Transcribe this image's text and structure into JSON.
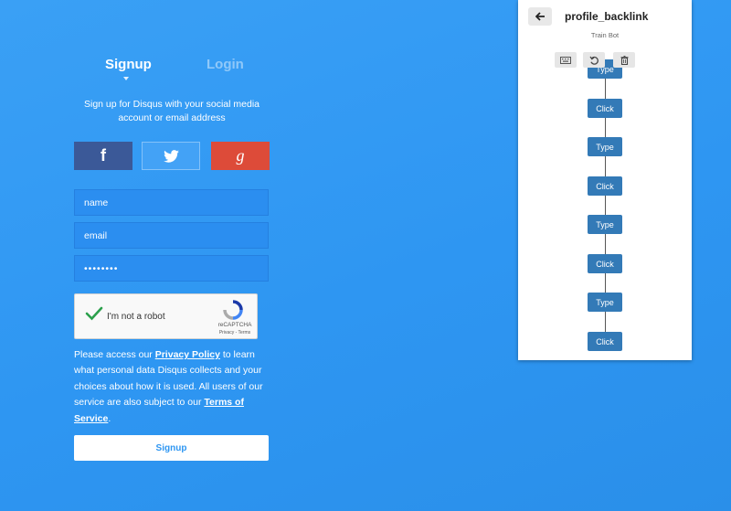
{
  "auth": {
    "tabs": [
      {
        "label": "Signup"
      },
      {
        "label": "Login"
      }
    ],
    "subtitle": "Sign up for Disqus with your social media account or email address",
    "social": [
      {
        "name": "facebook",
        "glyph": "f",
        "color": "#3b5998"
      },
      {
        "name": "twitter",
        "color": "#43a2f6"
      },
      {
        "name": "google",
        "glyph": "g",
        "color": "#dd4b39"
      }
    ],
    "fields": {
      "name_placeholder": "name",
      "email_placeholder": "email",
      "password_value": "••••••••"
    },
    "captcha": {
      "label": "I'm not a robot",
      "brand": "reCAPTCHA",
      "terms": "Privacy - Terms"
    },
    "policy": {
      "pre": "Please access our ",
      "privacy_link": "Privacy Policy",
      "mid": " to learn what personal data Disqus collects and your choices about how it is used. All users of our service are also subject to our ",
      "terms_link": "Terms of Service",
      "post": "."
    },
    "submit_label": "Signup"
  },
  "bot": {
    "title": "profile_backlink",
    "subtitle": "Train Bot",
    "icons": [
      "back-arrow-icon",
      "keyboard-icon",
      "undo-icon",
      "trash-icon"
    ],
    "steps": [
      "Type",
      "Click",
      "Type",
      "Click",
      "Type",
      "Click",
      "Type",
      "Click"
    ]
  },
  "colors": {
    "background": "#2e96f2",
    "step": "#337ab7",
    "accent": "#2e96f2"
  }
}
